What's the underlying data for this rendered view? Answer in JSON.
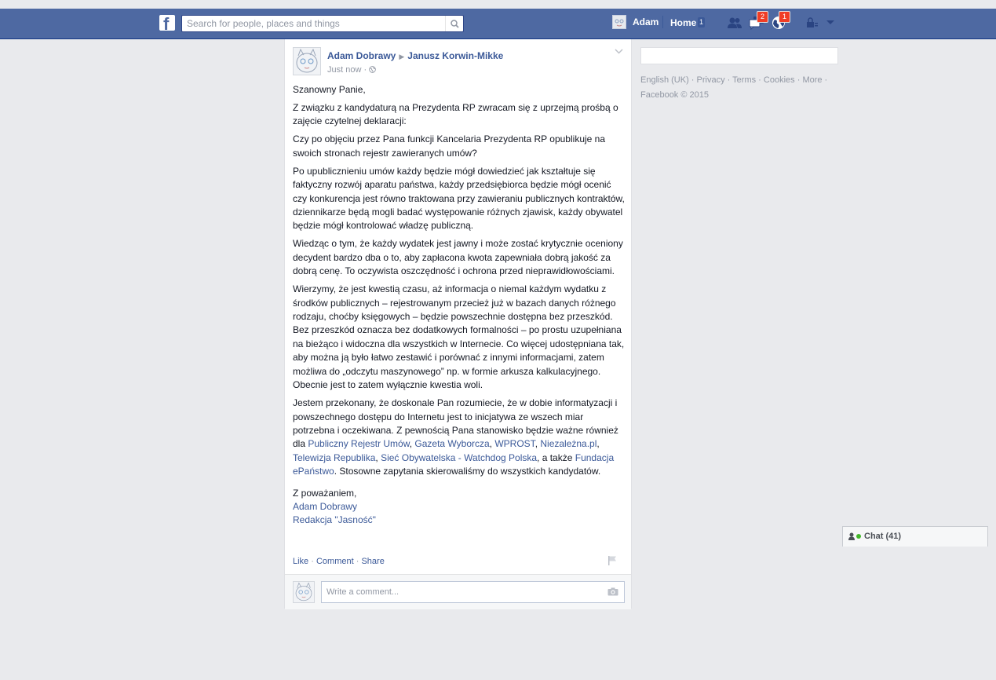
{
  "topbar": {
    "logo": "f",
    "search_placeholder": "Search for people, places and things",
    "user_name": "Adam",
    "home_label": "Home",
    "home_count": "1",
    "messages_count": "2",
    "notifications_count": "1"
  },
  "post": {
    "author": "Adam Dobrawy",
    "target": "Janusz Korwin-Mikke",
    "timestamp": "Just now",
    "paragraphs": {
      "p1": "Szanowny Panie,",
      "p2": "Z związku z kandydaturą na Prezydenta RP zwracam się z uprzejmą prośbą o zajęcie czytelnej deklaracji:",
      "p3": "Czy po objęciu przez Pana funkcji Kancelaria Prezydenta RP opublikuje na swoich stronach rejestr zawieranych umów?",
      "p4": "Po upublicznieniu umów każdy będzie mógł dowiedzieć jak kształtuje się faktyczny rozwój aparatu państwa, każdy przedsiębiorca będzie mógł ocenić czy konkurencja jest równo traktowana przy zawieraniu publicznych kontraktów, dziennikarze będą mogli badać występowanie różnych zjawisk, każdy obywatel będzie mógł kontrolować władzę publiczną.",
      "p5": "Wiedząc o tym, że każdy wydatek jest jawny i może zostać krytycznie oceniony decydent bardzo dba o to, aby zapłacona kwota zapewniała dobrą jakość za dobrą cenę. To oczywista oszczędność i ochrona przed nieprawidłowościami.",
      "p6": "Wierzymy, że jest kwestią czasu, aż informacja o niemal każdym wydatku z środków publicznych – rejestrowanym przecież już w bazach danych różnego rodzaju, choćby księgowych – będzie powszechnie dostępna bez przeszkód. Bez przeszkód oznacza bez dodatkowych formalności – po prostu uzupełniana na bieżąco i widoczna dla wszystkich w Internecie. Co więcej udostępniana tak, aby można ją było łatwo zestawić i porównać z innymi informacjami, zatem możliwa do „odczytu maszynowego” np. w formie arkusza kalkulacyjnego. Obecnie jest to zatem wyłącznie kwestia woli.",
      "p7_a": "Jestem przekonany, że doskonale Pan rozumiecie, że w dobie informatyzacji i powszechnego dostępu do Internetu jest to inicjatywa ze wszech miar potrzebna i oczekiwana. Z pewnością Pana stanowisko będzie ważne również dla ",
      "p7_b": ", a także ",
      "p7_c": ". Stosowne zapytania skierowaliśmy do wszystkich kandydatów.",
      "closing": "Z poważaniem,"
    },
    "mentions": {
      "m1": "Publiczny Rejestr Umów",
      "m2": "Gazeta Wyborcza",
      "m3": "WPROST",
      "m4": "Niezależna.pl",
      "m5": "Telewizja Republika",
      "m6": "Sieć Obywatelska - Watchdog Polska",
      "m7": "Fundacja ePaństwo"
    },
    "signature_name": "Adam Dobrawy",
    "signature_org": "Redakcja \"Jasność\"",
    "actions": {
      "like": "Like",
      "comment": "Comment",
      "share": "Share"
    },
    "comment_placeholder": "Write a comment..."
  },
  "footer": {
    "language": "English (UK)",
    "privacy": "Privacy",
    "terms": "Terms",
    "cookies": "Cookies",
    "more": "More",
    "copyright": "Facebook © 2015"
  },
  "chat": {
    "label": "Chat (41)"
  },
  "colors": {
    "bluebar": "#4e69a2",
    "link": "#3b5998",
    "badge": "#f03d25",
    "background": "#e9eaed"
  },
  "icons": [
    "facebook-logo-icon",
    "search-icon",
    "friends-icon",
    "messages-icon",
    "notifications-icon",
    "privacy-lock-icon",
    "dropdown-caret-icon",
    "globe-icon",
    "flag-icon",
    "camera-icon",
    "chevron-down-icon",
    "chat-user-icon"
  ]
}
